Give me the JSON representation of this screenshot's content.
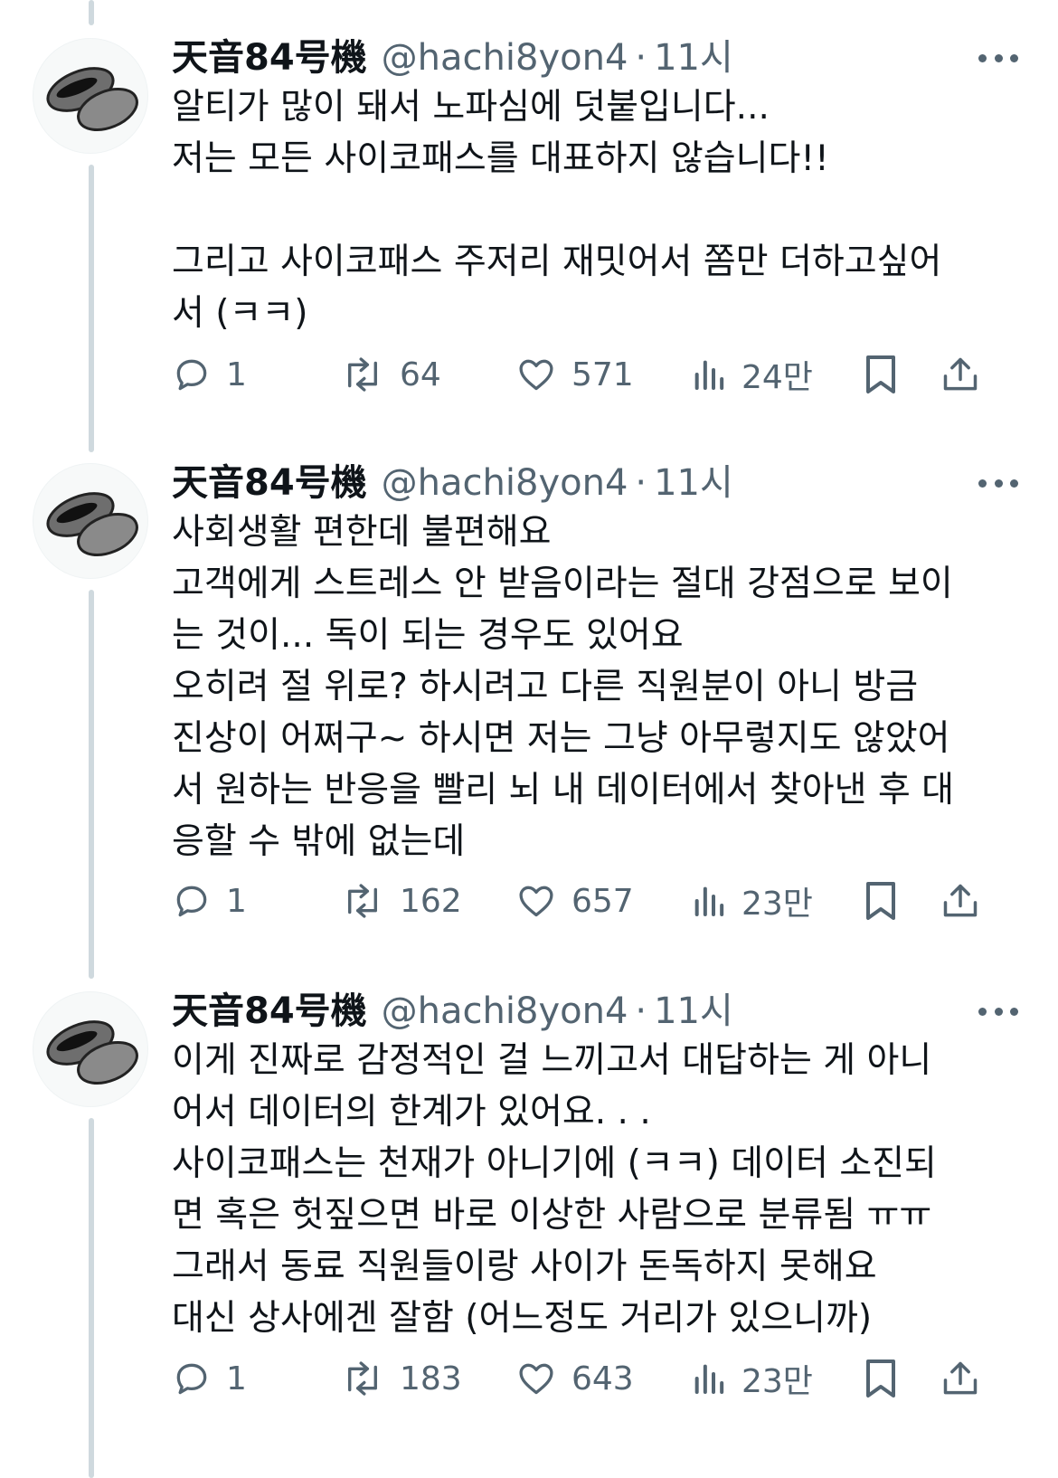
{
  "tweets": [
    {
      "author": {
        "name": "天音84号機",
        "handle": "@hachi8yon4",
        "time": "11시",
        "separator": "·"
      },
      "lines": [
        "알티가 많이 돼서 노파심에 덧붙입니다...",
        "저는 모든 사이코패스를 대표하지 않습니다!!",
        "",
        "그리고 사이코패스 주저리 재밋어서 쫌만 더하고싶어",
        "서 (ㅋㅋ)"
      ],
      "stats": {
        "replies": "1",
        "reposts": "64",
        "likes": "571",
        "views": "24만"
      }
    },
    {
      "author": {
        "name": "天音84号機",
        "handle": "@hachi8yon4",
        "time": "11시",
        "separator": "·"
      },
      "lines": [
        "사회생활 편한데 불편해요",
        "고객에게 스트레스 안 받음이라는 절대 강점으로 보이",
        "는 것이... 독이 되는 경우도 있어요",
        "오히려 절 위로? 하시려고 다른 직원분이 아니 방금",
        "진상이 어쩌구~ 하시면 저는 그냥 아무렇지도 않았어",
        "서 원하는 반응을 빨리 뇌 내 데이터에서 찾아낸 후 대",
        "응할 수 밖에 없는데"
      ],
      "stats": {
        "replies": "1",
        "reposts": "162",
        "likes": "657",
        "views": "23만"
      }
    },
    {
      "author": {
        "name": "天音84号機",
        "handle": "@hachi8yon4",
        "time": "11시",
        "separator": "·"
      },
      "lines": [
        "이게 진짜로 감정적인 걸 느끼고서 대답하는 게 아니",
        "어서 데이터의 한계가 있어요. . .",
        "사이코패스는 천재가 아니기에 (ㅋㅋ) 데이터 소진되",
        "면 혹은 헛짚으면 바로 이상한 사람으로 분류됨 ㅠㅠ",
        "그래서 동료 직원들이랑 사이가 돈독하지 못해요",
        "대신 상사에겐 잘함 (어느정도 거리가 있으니까)"
      ],
      "stats": {
        "replies": "1",
        "reposts": "183",
        "likes": "643",
        "views": "23만"
      }
    }
  ],
  "icons": {
    "avatar": "avatar-image",
    "more": "more-icon",
    "reply": "reply-icon",
    "repost": "repost-icon",
    "like": "like-icon",
    "views": "views-icon",
    "bookmark": "bookmark-icon",
    "share": "share-icon"
  },
  "colors": {
    "text": "#0f1419",
    "secondary": "#536471",
    "thread_line": "#cfd9de"
  }
}
